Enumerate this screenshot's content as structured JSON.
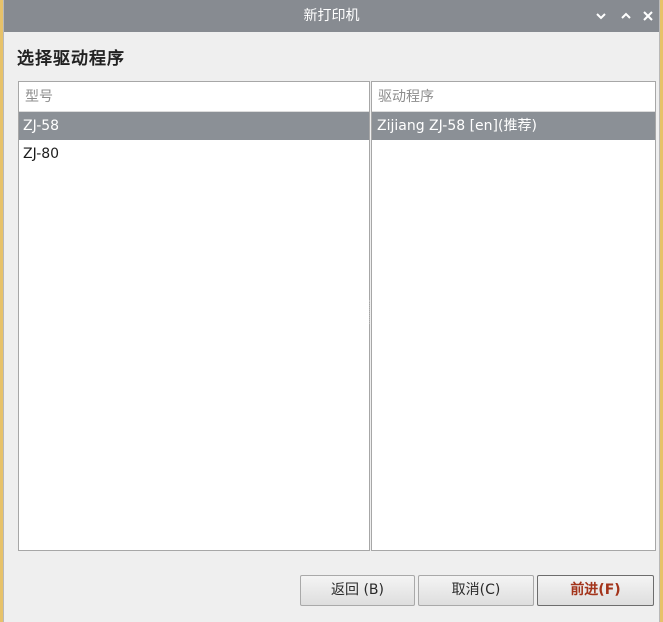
{
  "window": {
    "title": "新打印机"
  },
  "heading": "选择驱动程序",
  "models": {
    "header": "型号",
    "items": [
      {
        "label": "ZJ-58",
        "selected": true
      },
      {
        "label": "ZJ-80",
        "selected": false
      }
    ]
  },
  "drivers": {
    "header": "驱动程序",
    "items": [
      {
        "label": "Zijiang ZJ-58 [en](推荐)",
        "selected": true
      }
    ]
  },
  "buttons": {
    "back": "返回 (B)",
    "cancel": "取消(C)",
    "forward": "前进(F)"
  },
  "colors": {
    "titlebar": "#878b91",
    "selection": "#8b9096"
  }
}
